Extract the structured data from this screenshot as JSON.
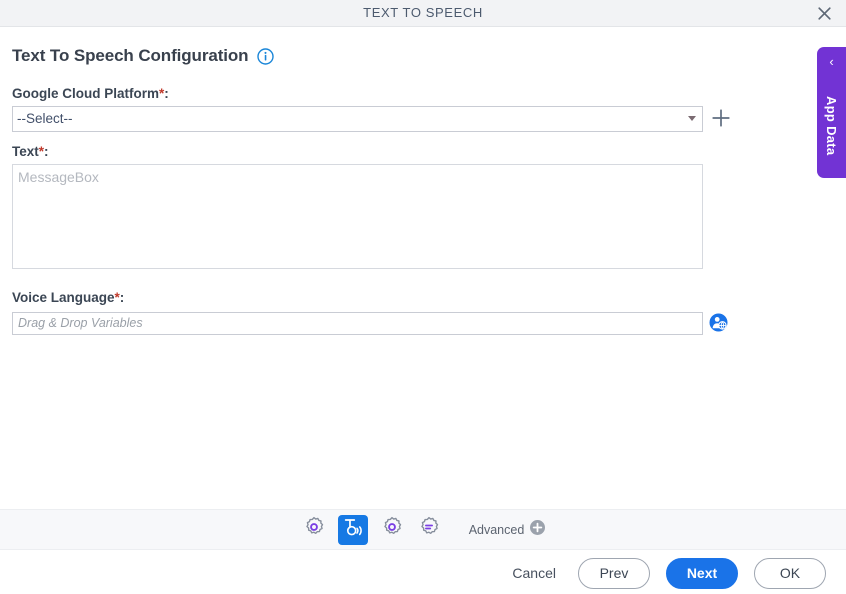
{
  "window": {
    "title": "TEXT TO SPEECH",
    "close_icon": "close-icon"
  },
  "side_tab": {
    "label": "App Data",
    "chevron": "‹",
    "color": "#7233d4"
  },
  "page": {
    "heading": "Text To Speech Configuration",
    "info_icon": "info-icon"
  },
  "fields": {
    "google_cloud_platform": {
      "label": "Google Cloud Platform",
      "required_mark": "*",
      "colon": ":",
      "selected_value": "--Select--",
      "add_icon": "plus-icon"
    },
    "text": {
      "label": "Text",
      "required_mark": "*",
      "colon": ":",
      "placeholder": "MessageBox",
      "value": ""
    },
    "voice_language": {
      "label": "Voice Language",
      "required_mark": "*",
      "colon": ":",
      "placeholder": "Drag & Drop Variables",
      "value": "",
      "picker_icon": "language-picker-icon"
    }
  },
  "toolbar": {
    "items": [
      {
        "name": "gear-icon",
        "active": false
      },
      {
        "name": "text-to-speech-icon",
        "active": true
      },
      {
        "name": "gear-icon",
        "active": false
      },
      {
        "name": "gear-list-icon",
        "active": false
      }
    ],
    "advanced_label": "Advanced",
    "advanced_add_icon": "plus-circle-icon"
  },
  "actions": {
    "cancel": "Cancel",
    "prev": "Prev",
    "next": "Next",
    "ok": "OK"
  },
  "colors": {
    "accent_blue": "#1a73e8",
    "tab_purple": "#7233d4",
    "required_red": "#c0392b",
    "icon_purple": "#7b3fe4"
  }
}
